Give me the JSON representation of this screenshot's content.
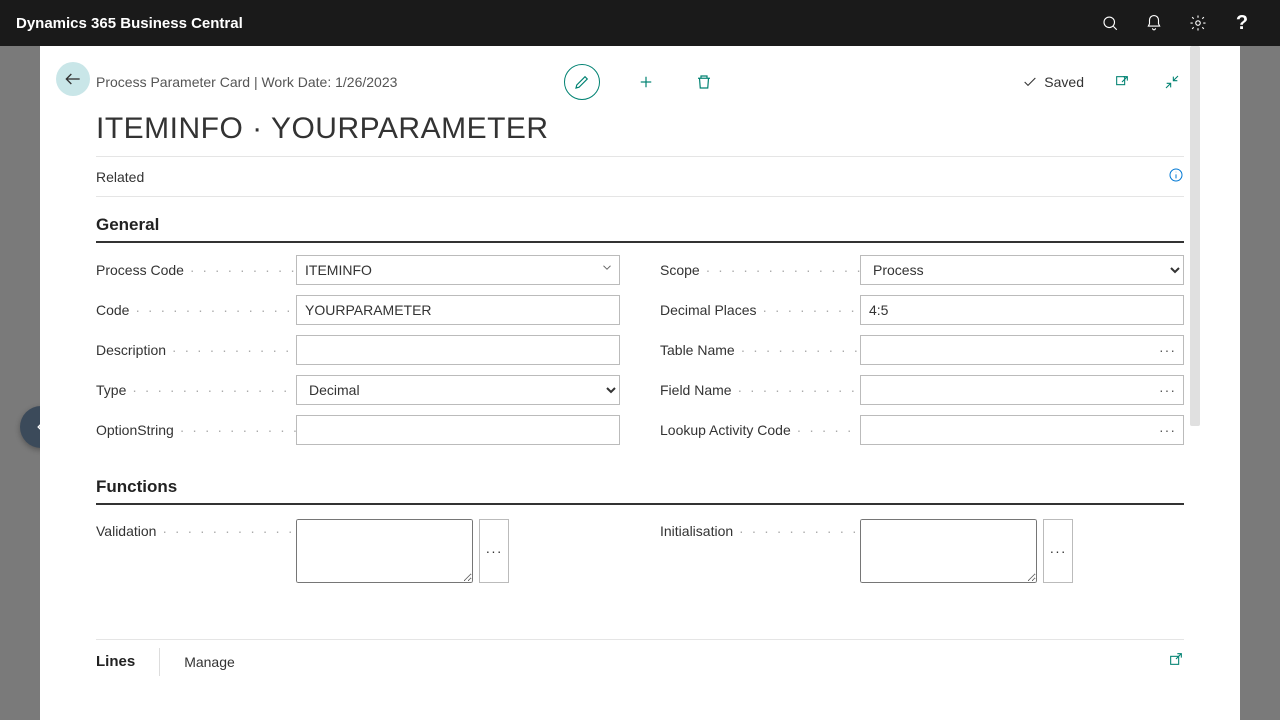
{
  "topbar": {
    "title": "Dynamics 365 Business Central"
  },
  "header": {
    "breadcrumb": "Process Parameter Card | Work Date: 1/26/2023",
    "saved_label": "Saved",
    "page_title": "ITEMINFO · YOURPARAMETER"
  },
  "related": {
    "label": "Related"
  },
  "sections": {
    "general_title": "General",
    "functions_title": "Functions",
    "lines_title": "Lines",
    "lines_manage": "Manage"
  },
  "fields": {
    "process_code": {
      "label": "Process Code",
      "value": "ITEMINFO"
    },
    "code": {
      "label": "Code",
      "value": "YOURPARAMETER"
    },
    "description": {
      "label": "Description",
      "value": ""
    },
    "type": {
      "label": "Type",
      "value": "Decimal",
      "options": [
        "Decimal"
      ]
    },
    "option_string": {
      "label": "OptionString",
      "value": ""
    },
    "scope": {
      "label": "Scope",
      "value": "Process",
      "options": [
        "Process"
      ]
    },
    "decimal_places": {
      "label": "Decimal Places",
      "value": "4:5"
    },
    "table_name": {
      "label": "Table Name",
      "value": ""
    },
    "field_name": {
      "label": "Field Name",
      "value": ""
    },
    "lookup_activity_code": {
      "label": "Lookup Activity Code",
      "value": ""
    },
    "validation": {
      "label": "Validation",
      "value": ""
    },
    "initialisation": {
      "label": "Initialisation",
      "value": ""
    }
  }
}
